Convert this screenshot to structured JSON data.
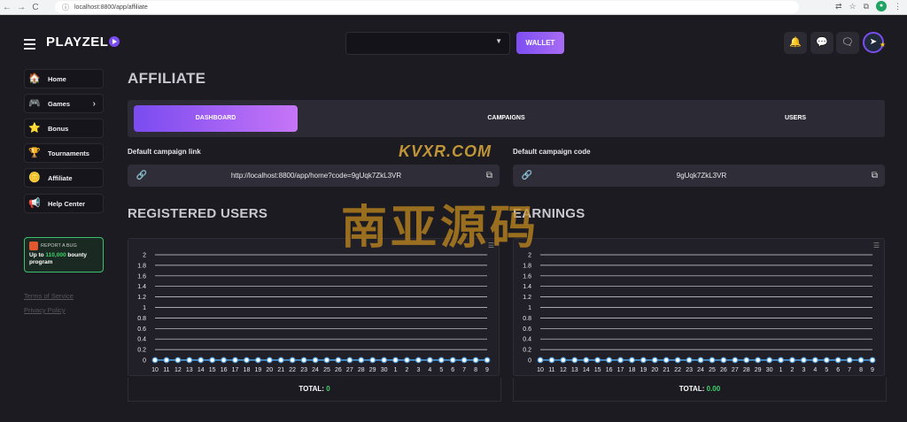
{
  "browser": {
    "url": "localhost:8800/app/affiliate",
    "back": "←",
    "forward": "→",
    "reload": "C"
  },
  "header": {
    "logo": "PLAYZEL",
    "wallet_label": "WALLET",
    "select_value": "",
    "icons": [
      "bell-icon",
      "chat-icon",
      "messages-icon"
    ]
  },
  "sidebar": {
    "items": [
      {
        "label": "Home",
        "icon": "🏠"
      },
      {
        "label": "Games",
        "icon": "🎮"
      },
      {
        "label": "Bonus",
        "icon": "⭐"
      },
      {
        "label": "Tournaments",
        "icon": "🏆"
      },
      {
        "label": "Affiliate",
        "icon": "🪙"
      },
      {
        "label": "Help Center",
        "icon": "📢"
      }
    ],
    "report": {
      "title": "REPORT A BUG",
      "line_prefix": "Up to ",
      "amount": "110,000",
      "line_suffix": " bounty program"
    },
    "terms": "Terms of Service",
    "privacy": "Privacy Policy"
  },
  "main": {
    "title": "AFFILIATE",
    "tabs": [
      "DASHBOARD",
      "CAMPAIGNS",
      "USERS"
    ],
    "campaign_link_label": "Default campaign link",
    "campaign_link": "http://localhost:8800/app/home?code=9gUqk7ZkL3VR",
    "campaign_code_label": "Default campaign code",
    "campaign_code": "9gUqk7ZkL3VR",
    "registered_title": "REGISTERED USERS",
    "earnings_title": "EARNINGS",
    "total_label": "TOTAL:",
    "registered_total": "0",
    "earnings_total": "0.00"
  },
  "watermark": {
    "line1": "KVXR.COM",
    "line2": "南亚源码"
  },
  "colors": {
    "accent": "#7b4df1",
    "green": "#3fd16b",
    "line": "#4fa3e8"
  },
  "chart_data": [
    {
      "type": "line",
      "x": [
        "10",
        "11",
        "12",
        "13",
        "14",
        "15",
        "16",
        "17",
        "18",
        "19",
        "20",
        "21",
        "22",
        "23",
        "24",
        "25",
        "26",
        "27",
        "28",
        "29",
        "30",
        "1",
        "2",
        "3",
        "4",
        "5",
        "6",
        "7",
        "8",
        "9"
      ],
      "values": [
        0,
        0,
        0,
        0,
        0,
        0,
        0,
        0,
        0,
        0,
        0,
        0,
        0,
        0,
        0,
        0,
        0,
        0,
        0,
        0,
        0,
        0,
        0,
        0,
        0,
        0,
        0,
        0,
        0,
        0
      ],
      "yticks": [
        "0",
        "0.2",
        "0.4",
        "0.6",
        "0.8",
        "1",
        "1.2",
        "1.4",
        "1.6",
        "1.8",
        "2"
      ],
      "ylim": [
        0,
        2
      ]
    },
    {
      "type": "line",
      "x": [
        "10",
        "11",
        "12",
        "13",
        "14",
        "15",
        "16",
        "17",
        "18",
        "19",
        "20",
        "21",
        "22",
        "23",
        "24",
        "25",
        "26",
        "27",
        "28",
        "29",
        "30",
        "1",
        "2",
        "3",
        "4",
        "5",
        "6",
        "7",
        "8",
        "9"
      ],
      "values": [
        0,
        0,
        0,
        0,
        0,
        0,
        0,
        0,
        0,
        0,
        0,
        0,
        0,
        0,
        0,
        0,
        0,
        0,
        0,
        0,
        0,
        0,
        0,
        0,
        0,
        0,
        0,
        0,
        0,
        0
      ],
      "yticks": [
        "0",
        "0.2",
        "0.4",
        "0.6",
        "0.8",
        "1",
        "1.2",
        "1.4",
        "1.6",
        "1.8",
        "2"
      ],
      "ylim": [
        0,
        2
      ]
    }
  ]
}
